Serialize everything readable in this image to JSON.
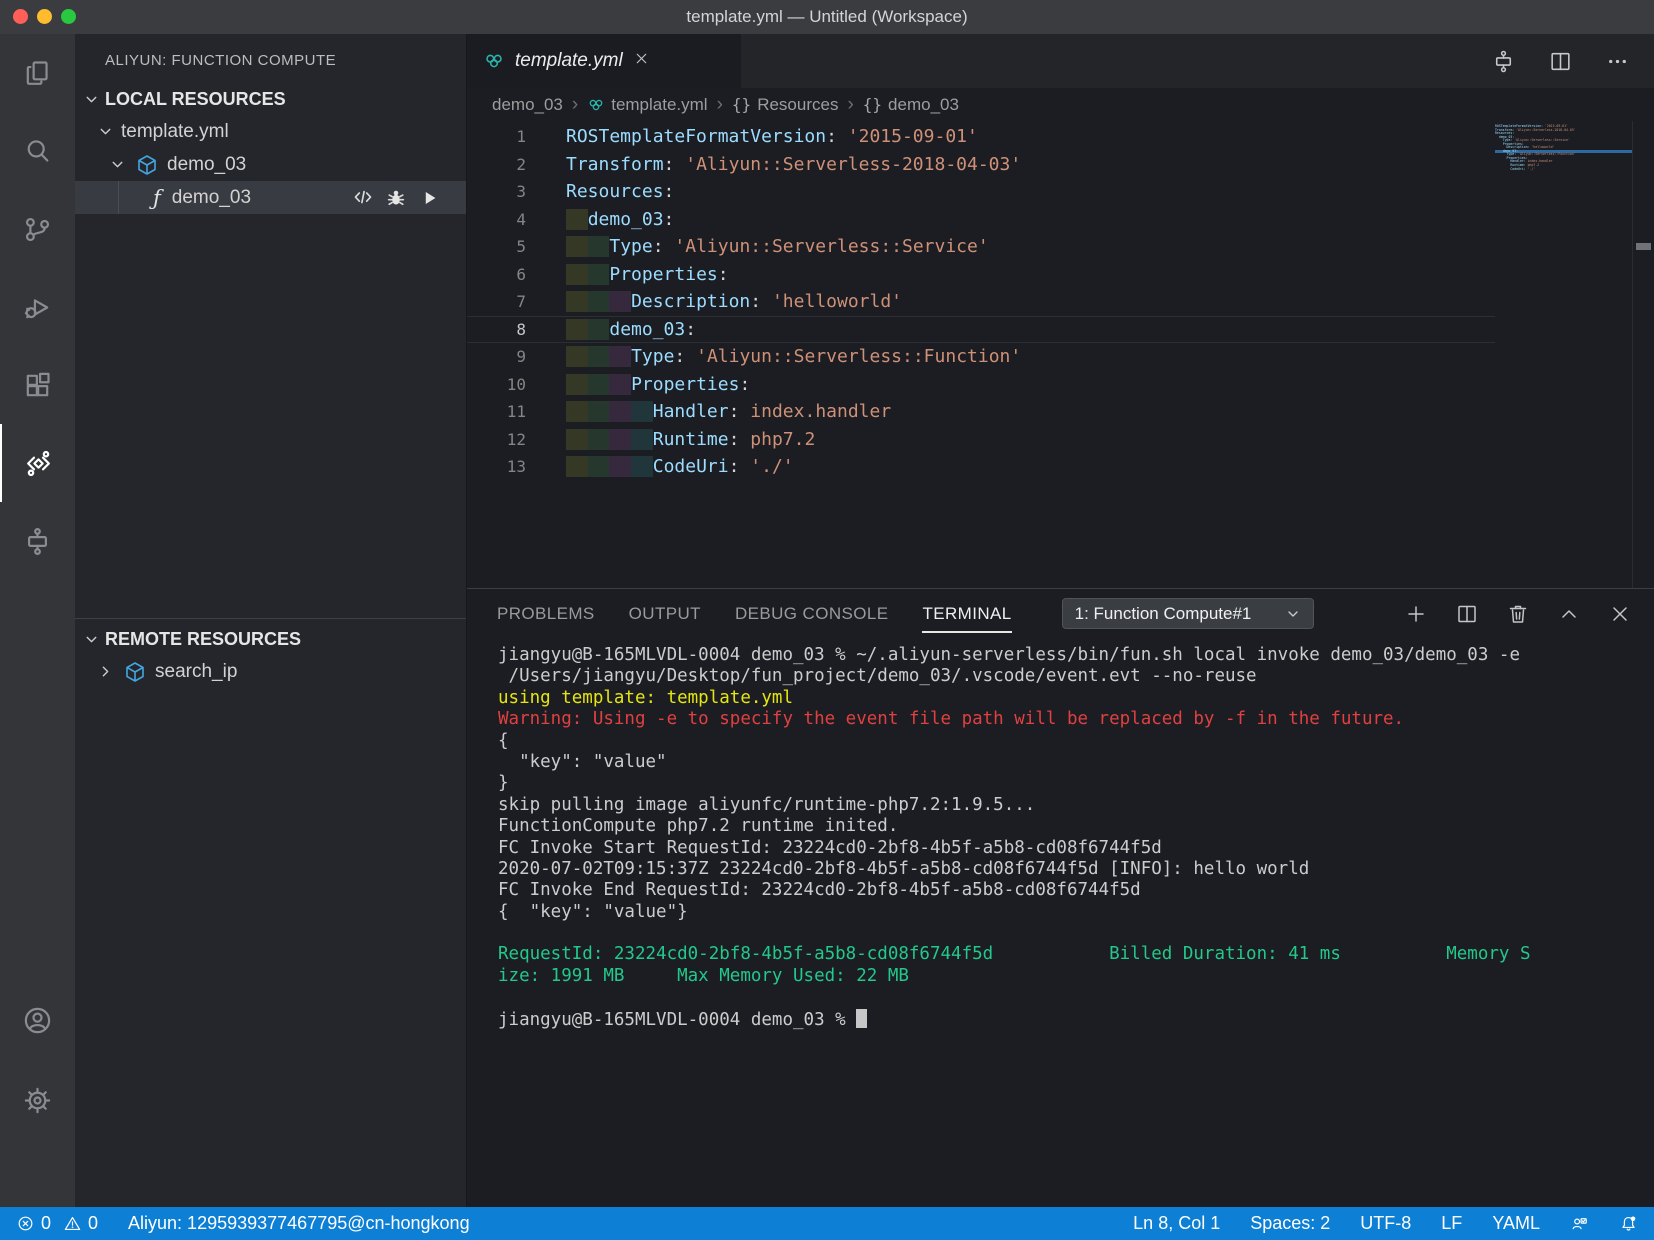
{
  "window": {
    "title": "template.yml — Untitled (Workspace)"
  },
  "colors": {
    "statusbar_accent": "#0d7fd4",
    "yaml_key": "#9cdcfe",
    "yaml_string": "#ce9178",
    "terminal_yellow": "#e5e510",
    "terminal_red": "#e04040",
    "terminal_green": "#23c88a",
    "cube_icon": "#42a5e0",
    "ros_icon": "#2ab5aa"
  },
  "activity_bar": {
    "items": [
      "explorer",
      "search",
      "source-control",
      "run-debug",
      "extensions",
      "aliyun-function-compute",
      "resource-flow"
    ],
    "active": "aliyun-function-compute",
    "bottom_items": [
      "accounts",
      "settings"
    ]
  },
  "sidebar": {
    "view_title": "ALIYUN: FUNCTION COMPUTE",
    "local_section": {
      "label": "LOCAL RESOURCES"
    },
    "tree": {
      "template_file": "template.yml",
      "service_label": "demo_03",
      "function_label": "demo_03",
      "row_actions": [
        "code",
        "debug",
        "run"
      ]
    },
    "remote_section": {
      "label": "REMOTE RESOURCES",
      "item": "search_ip"
    }
  },
  "editor": {
    "tab": {
      "label": "template.yml"
    },
    "breadcrumbs": [
      {
        "label": "demo_03",
        "icon": "none"
      },
      {
        "label": "template.yml",
        "icon": "ros"
      },
      {
        "label": "Resources",
        "icon": "braces"
      },
      {
        "label": "demo_03",
        "icon": "braces"
      }
    ],
    "code_lines": [
      {
        "n": 1,
        "indent": 0,
        "tokens": [
          [
            "k",
            "ROSTemplateFormatVersion"
          ],
          [
            "p",
            ": "
          ],
          [
            "s",
            "'2015-09-01'"
          ]
        ]
      },
      {
        "n": 2,
        "indent": 0,
        "tokens": [
          [
            "k",
            "Transform"
          ],
          [
            "p",
            ": "
          ],
          [
            "s",
            "'Aliyun::Serverless-2018-04-03'"
          ]
        ]
      },
      {
        "n": 3,
        "indent": 0,
        "tokens": [
          [
            "k",
            "Resources"
          ],
          [
            "p",
            ":"
          ]
        ]
      },
      {
        "n": 4,
        "indent": 1,
        "tokens": [
          [
            "k",
            "demo_03"
          ],
          [
            "p",
            ":"
          ]
        ]
      },
      {
        "n": 5,
        "indent": 2,
        "tokens": [
          [
            "k",
            "Type"
          ],
          [
            "p",
            ": "
          ],
          [
            "s",
            "'Aliyun::Serverless::Service'"
          ]
        ]
      },
      {
        "n": 6,
        "indent": 2,
        "tokens": [
          [
            "k",
            "Properties"
          ],
          [
            "p",
            ":"
          ]
        ]
      },
      {
        "n": 7,
        "indent": 3,
        "tokens": [
          [
            "k",
            "Description"
          ],
          [
            "p",
            ": "
          ],
          [
            "s",
            "'helloworld'"
          ]
        ]
      },
      {
        "n": 8,
        "indent": 2,
        "tokens": [
          [
            "k",
            "demo_03"
          ],
          [
            "p",
            ":"
          ]
        ],
        "current": true
      },
      {
        "n": 9,
        "indent": 3,
        "tokens": [
          [
            "k",
            "Type"
          ],
          [
            "p",
            ": "
          ],
          [
            "s",
            "'Aliyun::Serverless::Function'"
          ]
        ]
      },
      {
        "n": 10,
        "indent": 3,
        "tokens": [
          [
            "k",
            "Properties"
          ],
          [
            "p",
            ":"
          ]
        ]
      },
      {
        "n": 11,
        "indent": 4,
        "tokens": [
          [
            "k",
            "Handler"
          ],
          [
            "p",
            ": "
          ],
          [
            "s",
            "index.handler"
          ]
        ]
      },
      {
        "n": 12,
        "indent": 4,
        "tokens": [
          [
            "k",
            "Runtime"
          ],
          [
            "p",
            ": "
          ],
          [
            "s",
            "php7.2"
          ]
        ]
      },
      {
        "n": 13,
        "indent": 4,
        "tokens": [
          [
            "k",
            "CodeUri"
          ],
          [
            "p",
            ": "
          ],
          [
            "s",
            "'./'"
          ]
        ]
      }
    ]
  },
  "panel": {
    "tabs": [
      "PROBLEMS",
      "OUTPUT",
      "DEBUG CONSOLE",
      "TERMINAL"
    ],
    "active_tab_index": 3,
    "terminal_select": "1: Function Compute#1",
    "terminal_lines": [
      {
        "text": "jiangyu@B-165MLVDL-0004 demo_03 % ~/.aliyun-serverless/bin/fun.sh local invoke demo_03/demo_03 -e",
        "cls": ""
      },
      {
        "text": " /Users/jiangyu/Desktop/fun_project/demo_03/.vscode/event.evt --no-reuse",
        "cls": ""
      },
      {
        "text": "using template: template.yml",
        "cls": "t-yellow"
      },
      {
        "text": "Warning: Using -e to specify the event file path will be replaced by -f in the future.",
        "cls": "t-red"
      },
      {
        "text": "{",
        "cls": ""
      },
      {
        "text": "  \"key\": \"value\"",
        "cls": ""
      },
      {
        "text": "}",
        "cls": ""
      },
      {
        "text": "skip pulling image aliyunfc/runtime-php7.2:1.9.5...",
        "cls": ""
      },
      {
        "text": "FunctionCompute php7.2 runtime inited.",
        "cls": ""
      },
      {
        "text": "FC Invoke Start RequestId: 23224cd0-2bf8-4b5f-a5b8-cd08f6744f5d",
        "cls": ""
      },
      {
        "text": "2020-07-02T09:15:37Z 23224cd0-2bf8-4b5f-a5b8-cd08f6744f5d [INFO]: hello world",
        "cls": ""
      },
      {
        "text": "FC Invoke End RequestId: 23224cd0-2bf8-4b5f-a5b8-cd08f6744f5d",
        "cls": ""
      },
      {
        "text": "{  \"key\": \"value\"}",
        "cls": ""
      },
      {
        "text": "",
        "cls": ""
      },
      {
        "text": "RequestId: 23224cd0-2bf8-4b5f-a5b8-cd08f6744f5d           Billed Duration: 41 ms          Memory S",
        "cls": "t-green"
      },
      {
        "text": "ize: 1991 MB     Max Memory Used: 22 MB",
        "cls": "t-green"
      },
      {
        "text": "",
        "cls": ""
      },
      {
        "text": "jiangyu@B-165MLVDL-0004 demo_03 % ",
        "cls": "",
        "cursor": true
      }
    ]
  },
  "status_bar": {
    "errors": "0",
    "warnings": "0",
    "account": "Aliyun: 1295939377467795@cn-hongkong",
    "cursor": "Ln 8, Col 1",
    "indent": "Spaces: 2",
    "encoding": "UTF-8",
    "eol": "LF",
    "language": "YAML"
  }
}
